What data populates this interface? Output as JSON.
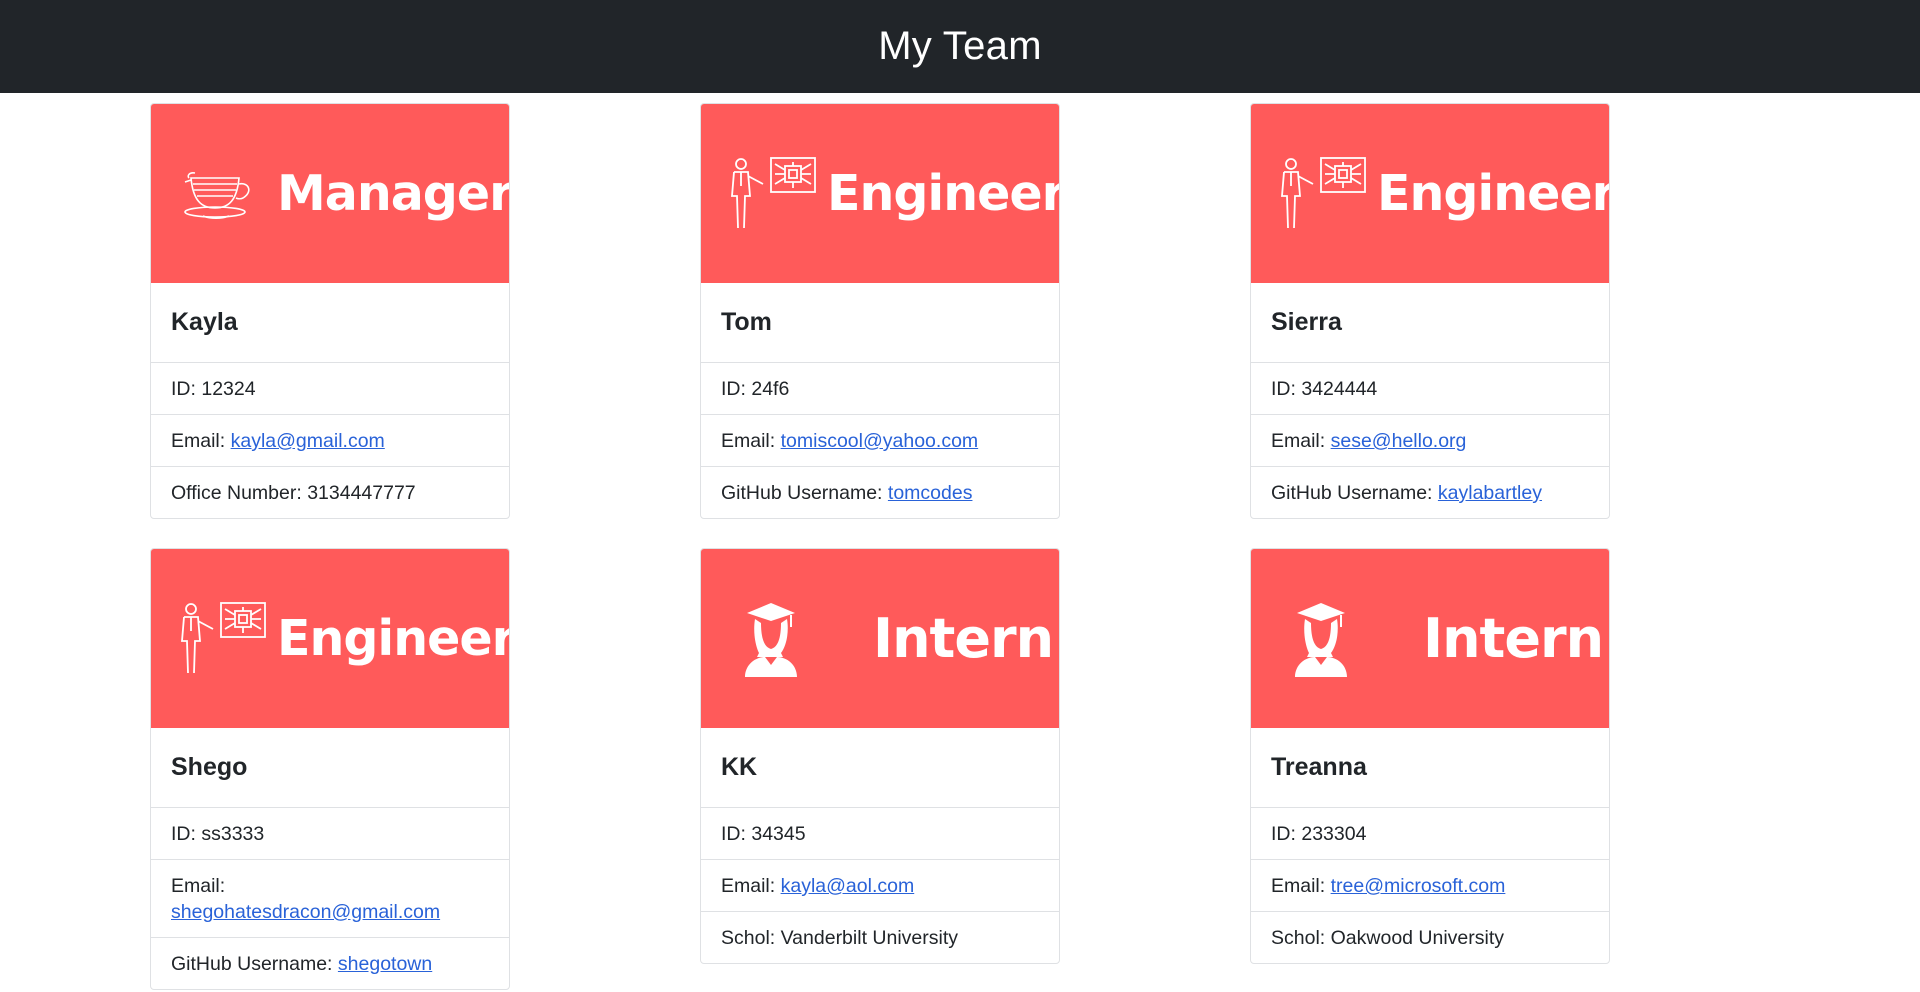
{
  "navbar": {
    "title": "My Team"
  },
  "colors": {
    "banner": "#ff5a5a",
    "navbar": "#212529",
    "link": "#2962d8"
  },
  "cards": [
    {
      "role": "Manager",
      "icon": "teacup-icon",
      "name": "Kayla",
      "id_label": "ID: ",
      "id": "12324",
      "email_label": "Email: ",
      "email": "kayla@gmail.com",
      "extra_label": "Office Number: ",
      "extra": "3134447777"
    },
    {
      "role": "Engineer",
      "icon": "engineer-presenting-icon",
      "name": "Tom",
      "id_label": "ID: ",
      "id": "24f6",
      "email_label": "Email: ",
      "email": "tomiscool@yahoo.com",
      "extra_label": "GitHub Username: ",
      "extra": "tomcodes"
    },
    {
      "role": "Engineer",
      "icon": "engineer-presenting-icon",
      "name": "Sierra",
      "id_label": "ID: ",
      "id": "3424444",
      "email_label": "Email: ",
      "email": "sese@hello.org",
      "extra_label": "GitHub Username: ",
      "extra": "kaylabartley"
    },
    {
      "role": "Engineer",
      "icon": "engineer-presenting-icon",
      "name": "Shego",
      "id_label": "ID: ",
      "id": "ss3333",
      "email_label": "Email: ",
      "email": "shegohatesdracon@gmail.com",
      "extra_label": "GitHub Username: ",
      "extra": "shegotown"
    },
    {
      "role": "Intern",
      "icon": "graduate-icon",
      "name": "KK",
      "id_label": "ID: ",
      "id": "34345",
      "email_label": "Email: ",
      "email": "kayla@aol.com",
      "extra_label": "Schol: ",
      "extra": "Vanderbilt University"
    },
    {
      "role": "Intern",
      "icon": "graduate-icon",
      "name": "Treanna",
      "id_label": "ID: ",
      "id": "233304",
      "email_label": "Email: ",
      "email": "tree@microsoft.com",
      "extra_label": "Schol: ",
      "extra": "Oakwood University"
    }
  ]
}
